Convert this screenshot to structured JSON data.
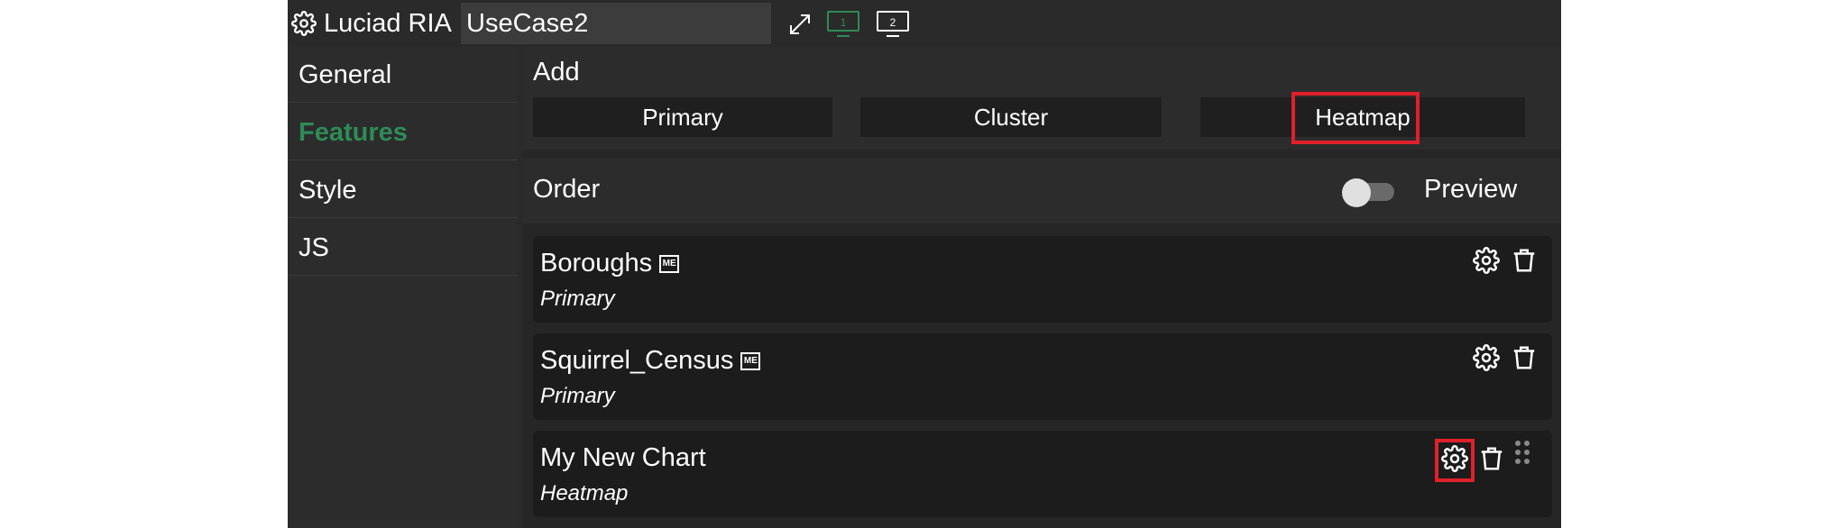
{
  "header": {
    "app_title": "Luciad RIA",
    "name_value": "UseCase2",
    "screen1_label": "1",
    "screen2_label": "2",
    "icons": [
      "gear-icon",
      "expand-icon",
      "monitor-1-icon",
      "monitor-2-icon"
    ]
  },
  "sidebar": {
    "items": [
      {
        "label": "General"
      },
      {
        "label": "Features"
      },
      {
        "label": "Style"
      },
      {
        "label": "JS"
      }
    ],
    "active": "Features"
  },
  "add": {
    "label": "Add",
    "buttons": [
      {
        "label": "Primary"
      },
      {
        "label": "Cluster"
      },
      {
        "label": "Heatmap"
      }
    ]
  },
  "order": {
    "label": "Order",
    "preview_label": "Preview",
    "preview_enabled": false
  },
  "features": [
    {
      "name": "Boroughs",
      "badge": "ME",
      "type": "Primary"
    },
    {
      "name": "Squirrel_Census",
      "badge": "ME",
      "type": "Primary"
    },
    {
      "name": "My New Chart",
      "type": "Heatmap"
    }
  ],
  "colors": {
    "background": "#2a2a2a",
    "active_nav": "#2e8b57",
    "highlight": "#e0202a",
    "monitor_active": "#2e8b57"
  }
}
